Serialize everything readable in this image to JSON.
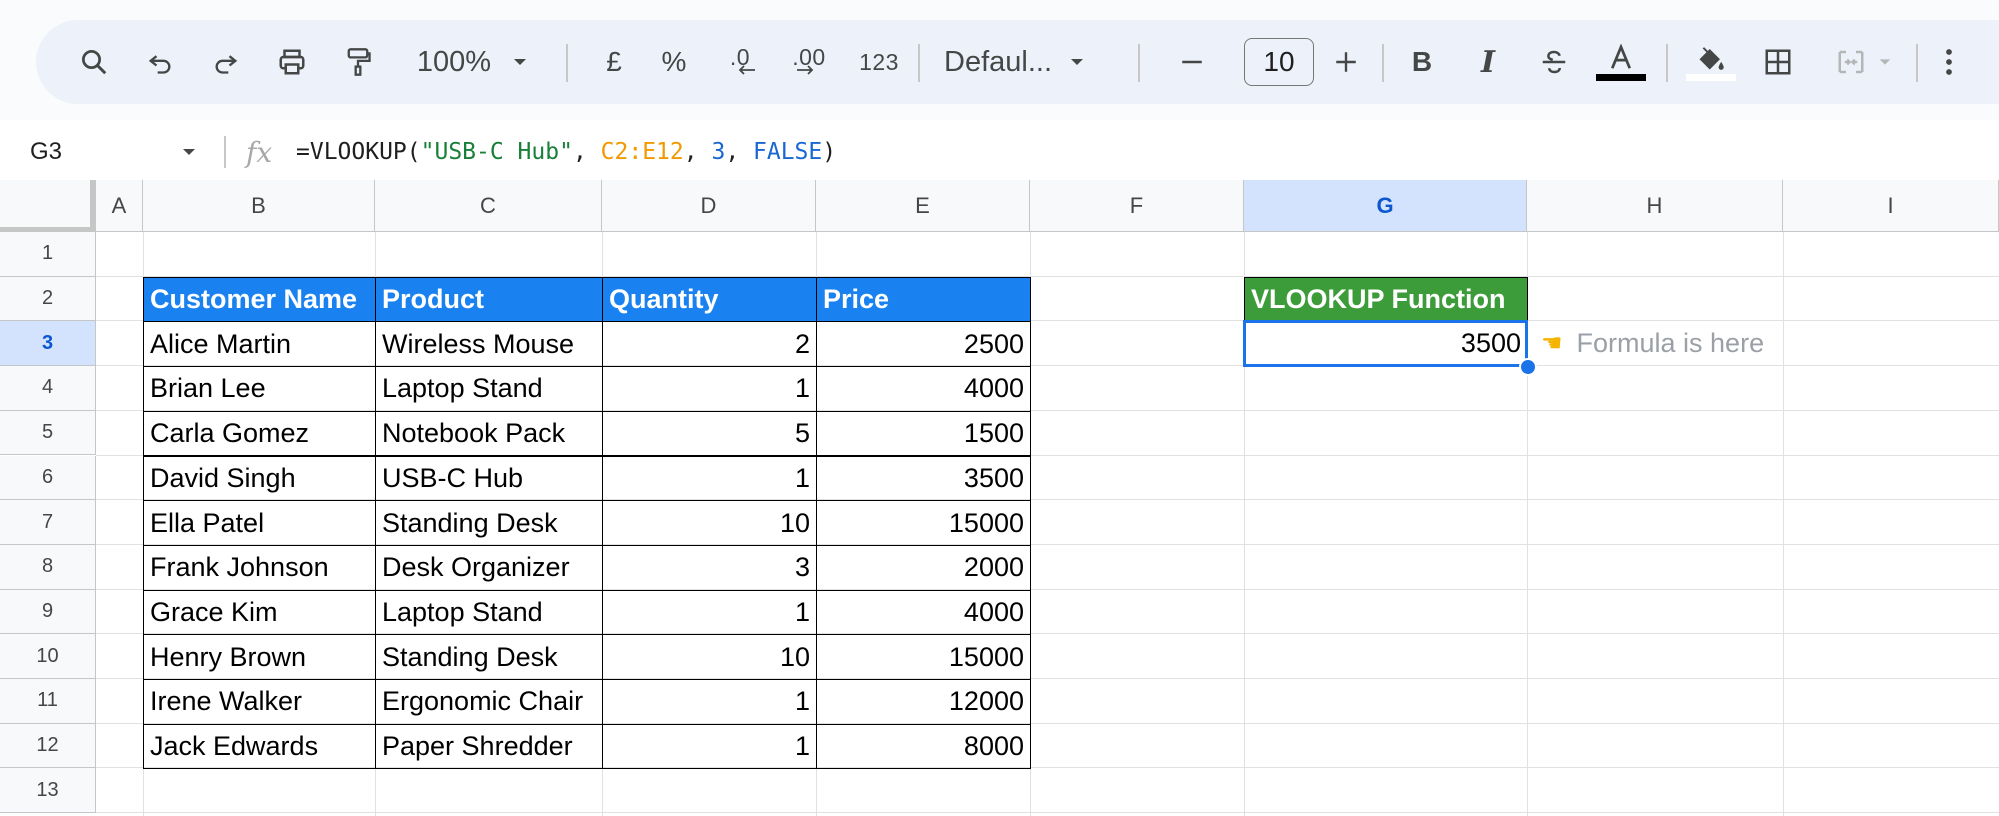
{
  "toolbar": {
    "zoom": "100%",
    "currency": "£",
    "percent": "%",
    "dec_decrease": ".0",
    "dec_increase": ".00",
    "number_format": "123",
    "font": "Defaul...",
    "font_size": "10",
    "text_color": "#000000",
    "fill_color": "#ffffff"
  },
  "formula_bar": {
    "name_box": "G3",
    "fx": "fx",
    "formula_prefix": "=VLOOKUP(",
    "formula_string": "\"USB-C Hub\"",
    "formula_sep1": ", ",
    "formula_range": "C2:E12",
    "formula_sep2": ", ",
    "formula_index": "3",
    "formula_sep3": ", ",
    "formula_bool": "FALSE",
    "formula_close": ")"
  },
  "columns": [
    "A",
    "B",
    "C",
    "D",
    "E",
    "F",
    "G",
    "H",
    "I"
  ],
  "selected_column": "G",
  "rows": [
    "1",
    "2",
    "3",
    "4",
    "5",
    "6",
    "7",
    "8",
    "9",
    "10",
    "11",
    "12",
    "13"
  ],
  "selected_row": "3",
  "table": {
    "headers": [
      "Customer Name",
      "Product",
      "Quantity",
      "Price"
    ],
    "rows": [
      [
        "Alice Martin",
        "Wireless Mouse",
        "2",
        "2500"
      ],
      [
        "Brian Lee",
        "Laptop Stand",
        "1",
        "4000"
      ],
      [
        "Carla Gomez",
        "Notebook Pack",
        "5",
        "1500"
      ],
      [
        "David Singh",
        "USB-C Hub",
        "1",
        "3500"
      ],
      [
        "Ella Patel",
        "Standing Desk",
        "10",
        "15000"
      ],
      [
        "Frank Johnson",
        "Desk Organizer",
        "3",
        "2000"
      ],
      [
        "Grace Kim",
        "Laptop Stand",
        "1",
        "4000"
      ],
      [
        "Henry Brown",
        "Standing Desk",
        "10",
        "15000"
      ],
      [
        "Irene Walker",
        "Ergonomic Chair",
        "1",
        "12000"
      ],
      [
        "Jack Edwards",
        "Paper Shredder",
        "1",
        "8000"
      ]
    ]
  },
  "lookup": {
    "header": "VLOOKUP Function",
    "result": "3500",
    "note": "Formula is here",
    "note_icon": "pointing-hand-icon"
  },
  "colors": {
    "table_header": "#1a82f0",
    "lookup_header": "#3d9c3a",
    "selection": "#1a73e8"
  }
}
